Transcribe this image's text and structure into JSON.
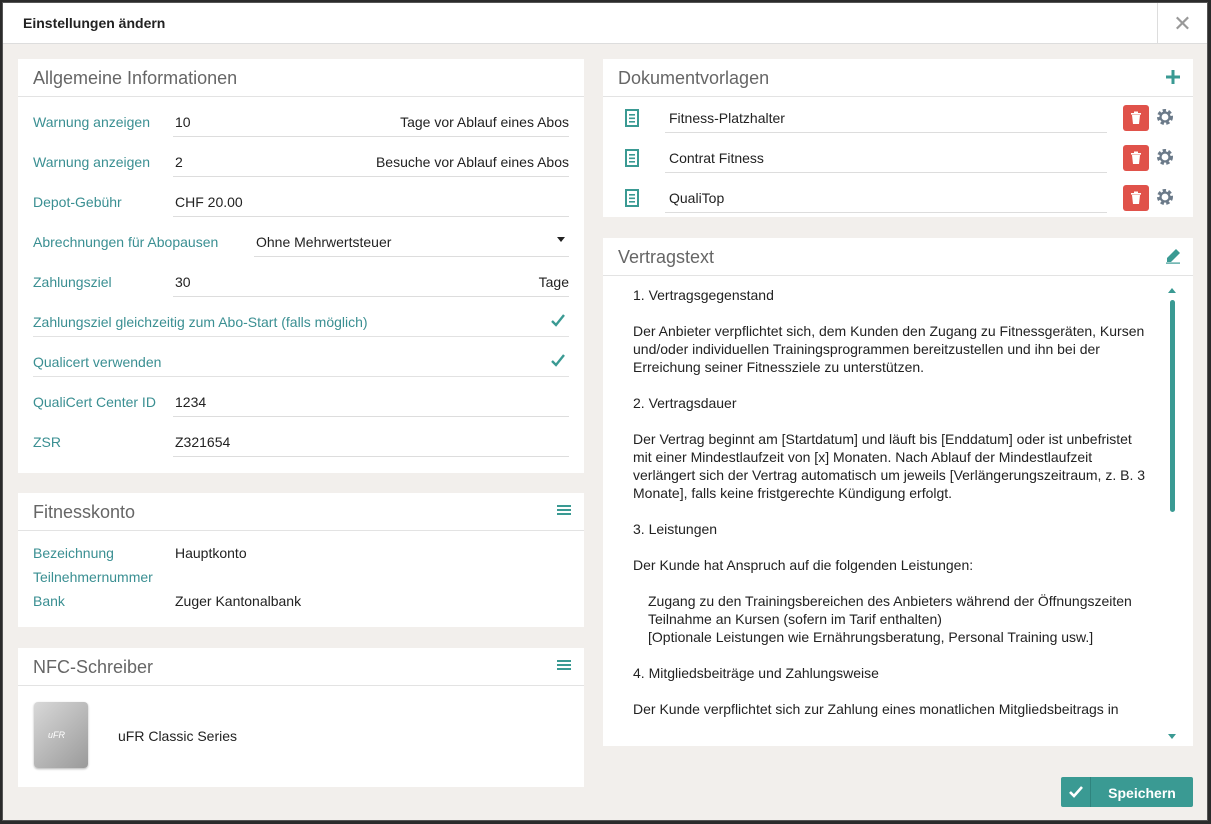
{
  "dialog": {
    "title": "Einstellungen ändern",
    "close_symbol": "✕"
  },
  "general": {
    "title": "Allgemeine Informationen",
    "rows": [
      {
        "label": "Warnung anzeigen",
        "value": "10",
        "suffix": "Tage vor Ablauf eines Abos"
      },
      {
        "label": "Warnung anzeigen",
        "value": "2",
        "suffix": "Besuche vor Ablauf eines Abos"
      },
      {
        "label": "Depot-Gebühr",
        "value": "CHF 20.00"
      },
      {
        "label": "Abrechnungen für Abopausen",
        "value": "Ohne Mehrwertsteuer"
      },
      {
        "label": "Zahlungsziel",
        "value": "30",
        "suffix": "Tage"
      },
      {
        "label": "Zahlungsziel gleichzeitig zum Abo-Start (falls möglich)",
        "checked": true
      },
      {
        "label": "Qualicert verwenden",
        "checked": true
      },
      {
        "label": "QualiCert Center ID",
        "value": "1234"
      },
      {
        "label": "ZSR",
        "value": "Z321654"
      }
    ]
  },
  "account": {
    "title": "Fitnesskonto",
    "rows": [
      {
        "label": "Bezeichnung",
        "value": "Hauptkonto"
      },
      {
        "label": "Teilnehmernummer",
        "value": ""
      },
      {
        "label": "Bank",
        "value": "Zuger Kantonalbank"
      }
    ]
  },
  "nfc": {
    "title": "NFC-Schreiber",
    "device": "uFR Classic Series",
    "device_image_text": "uFR"
  },
  "templates": {
    "title": "Dokumentvorlagen",
    "items": [
      "Fitness-Platzhalter",
      "Contrat Fitness",
      "QualiTop"
    ]
  },
  "contract": {
    "title": "Vertragstext",
    "paragraphs": [
      "1. Vertragsgegenstand",
      "Der Anbieter verpflichtet sich, dem Kunden den Zugang zu Fitnessgeräten, Kursen und/oder individuellen Trainingsprogrammen bereitzustellen und ihn bei der Erreichung seiner Fitnessziele zu unterstützen.",
      "2. Vertragsdauer",
      "Der Vertrag beginnt am [Startdatum] und läuft bis [Enddatum] oder ist unbefristet mit einer Mindestlaufzeit von [x] Monaten. Nach Ablauf der Mindestlaufzeit verlängert sich der Vertrag automatisch um jeweils [Verlängerungszeitraum, z. B. 3 Monate], falls keine fristgerechte Kündigung erfolgt.",
      "3. Leistungen",
      "Der Kunde hat Anspruch auf die folgenden Leistungen:"
    ],
    "services": [
      "Zugang zu den Trainingsbereichen des Anbieters während der Öffnungszeiten",
      "Teilnahme an Kursen (sofern im Tarif enthalten)",
      "[Optionale Leistungen wie Ernährungsberatung, Personal Training usw.]"
    ],
    "paragraphs_after": [
      "4. Mitgliedsbeiträge und Zahlungsweise",
      "Der Kunde verpflichtet sich zur Zahlung eines monatlichen Mitgliedsbeitrags in"
    ]
  },
  "save_button": {
    "label": "Speichern"
  },
  "colors": {
    "accent": "#3a9a93",
    "label": "#3a8f92",
    "danger": "#e0524a",
    "background": "#f2efec"
  }
}
